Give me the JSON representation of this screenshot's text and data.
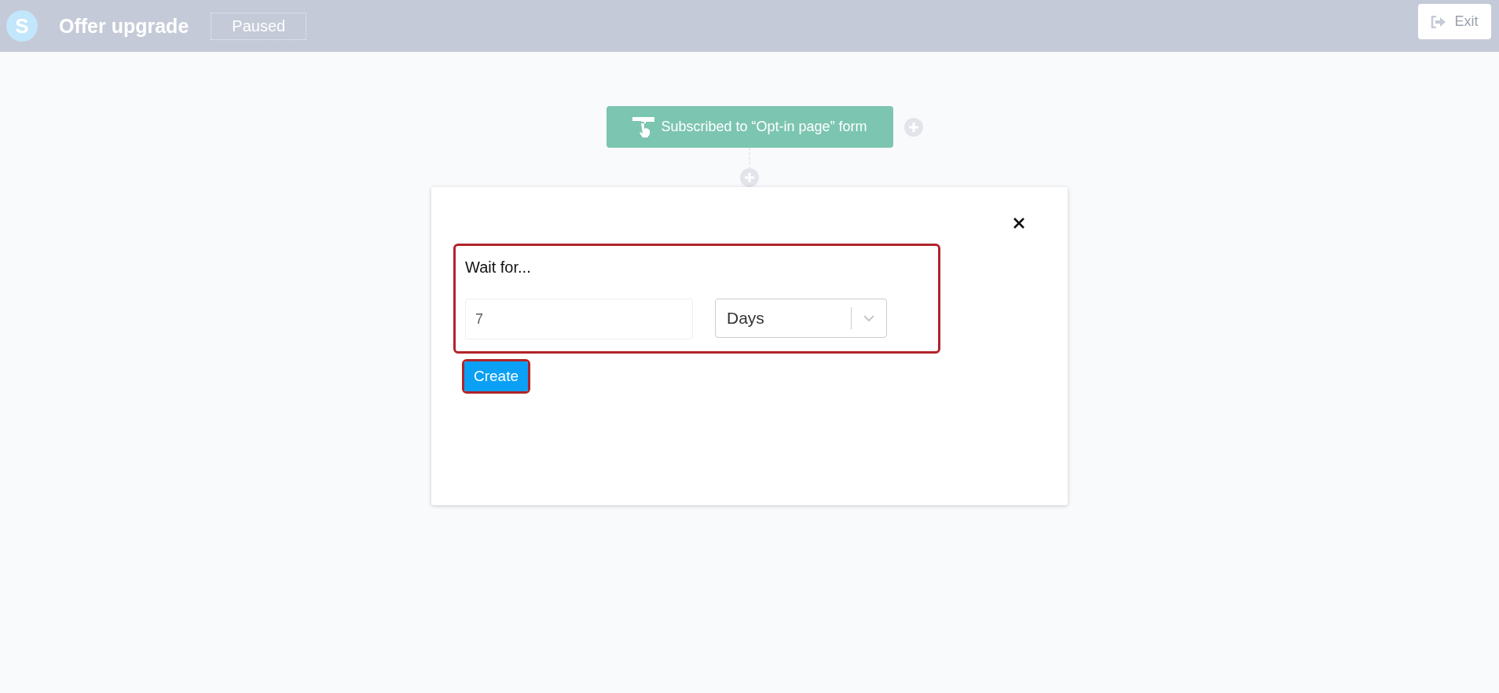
{
  "header": {
    "logo": "S",
    "title": "Offer upgrade",
    "status": "Paused",
    "exit_button": "Exit"
  },
  "workflow": {
    "trigger": {
      "label": "Subscribed to “Opt-in page” form"
    }
  },
  "modal": {
    "wait_section": {
      "label": "Wait for...",
      "highlighted": true,
      "amount": {
        "value": "7"
      },
      "unit": {
        "value": "Days"
      }
    },
    "create_button": {
      "label": "Create",
      "highlighted": true
    }
  }
}
